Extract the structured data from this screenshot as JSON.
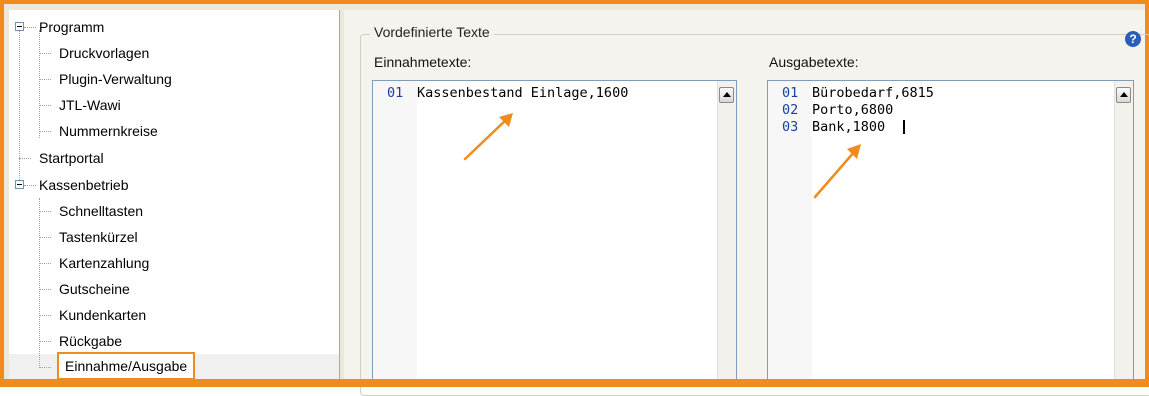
{
  "tree": {
    "items": [
      {
        "label": "Programm"
      },
      {
        "label": "Druckvorlagen"
      },
      {
        "label": "Plugin-Verwaltung"
      },
      {
        "label": "JTL-Wawi"
      },
      {
        "label": "Nummernkreise"
      },
      {
        "label": "Startportal"
      },
      {
        "label": "Kassenbetrieb"
      },
      {
        "label": "Schnelltasten"
      },
      {
        "label": "Tastenkürzel"
      },
      {
        "label": "Kartenzahlung"
      },
      {
        "label": "Gutscheine"
      },
      {
        "label": "Kundenkarten"
      },
      {
        "label": "Rückgabe"
      },
      {
        "label": "Einnahme/Ausgabe",
        "selected": true
      }
    ]
  },
  "group": {
    "title": "Vordefinierte Texte",
    "help_glyph": "?"
  },
  "einnahme": {
    "label": "Einnahmetexte:",
    "lines": [
      {
        "num": "01",
        "text": "Kassenbestand Einlage,1600"
      }
    ]
  },
  "ausgabe": {
    "label": "Ausgabetexte:",
    "lines": [
      {
        "num": "01",
        "text": "Bürobedarf,6815"
      },
      {
        "num": "02",
        "text": "Porto,6800"
      },
      {
        "num": "03",
        "text": "Bank,1800"
      }
    ]
  },
  "colors": {
    "highlight": "#f08c1e",
    "line_number": "#1a3fa0"
  },
  "icons": [
    "expand-collapse-icon",
    "scroll-up-icon",
    "help-icon",
    "annotation-arrow-icon"
  ]
}
